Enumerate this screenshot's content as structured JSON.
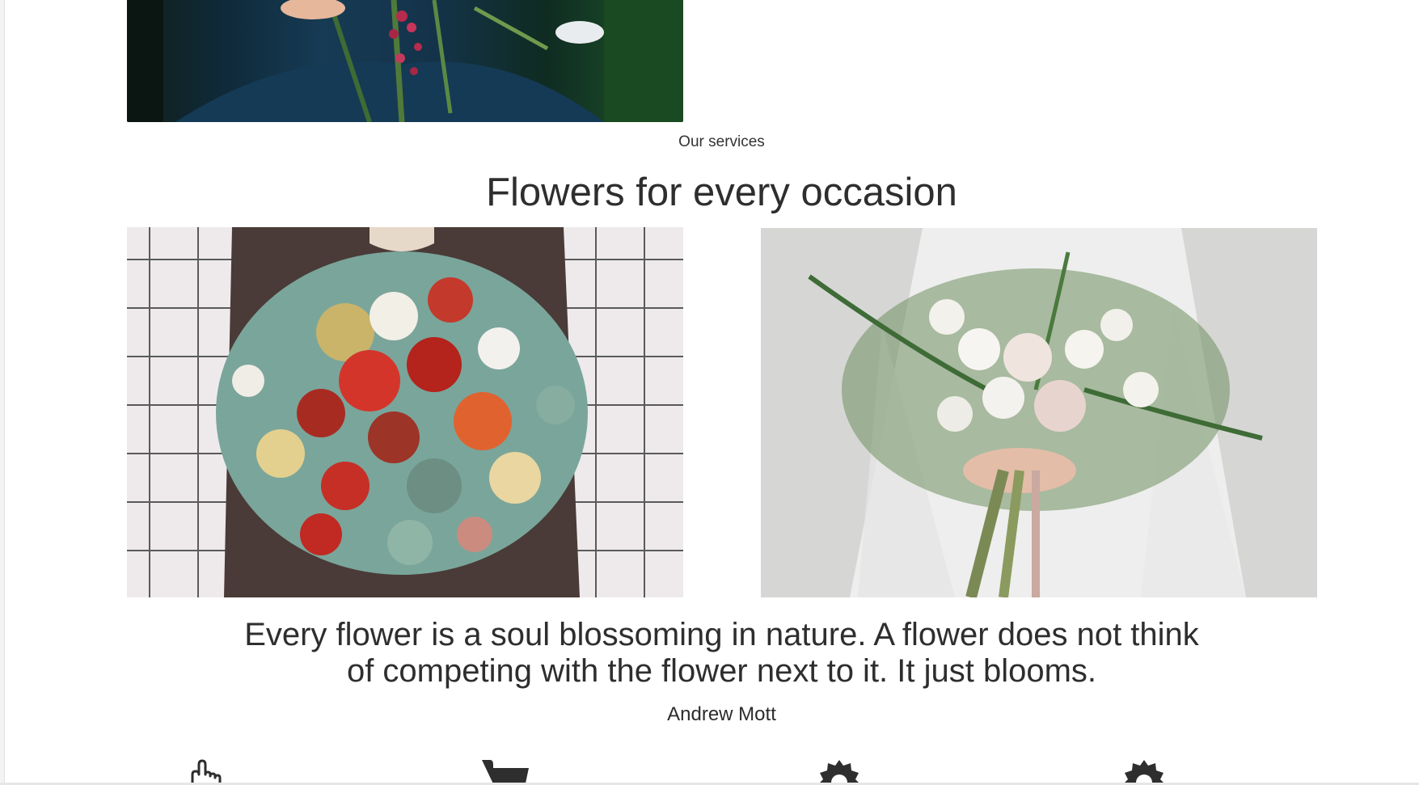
{
  "services": {
    "kicker": "Our services",
    "title": "Flowers for every occasion"
  },
  "quote": {
    "line1": "Every flower is a soul blossoming in nature. A flower does not think",
    "line2": "of competing with the flower next to it. It just blooms.",
    "author": "Andrew Mott"
  },
  "features": [
    {
      "icon": "pointer-hand-icon"
    },
    {
      "icon": "shopping-cart-icon"
    },
    {
      "icon": "gear-badge-icon"
    },
    {
      "icon": "gear-badge-icon"
    }
  ],
  "colors": {
    "text": "#2e2e2e",
    "background": "#ffffff"
  }
}
